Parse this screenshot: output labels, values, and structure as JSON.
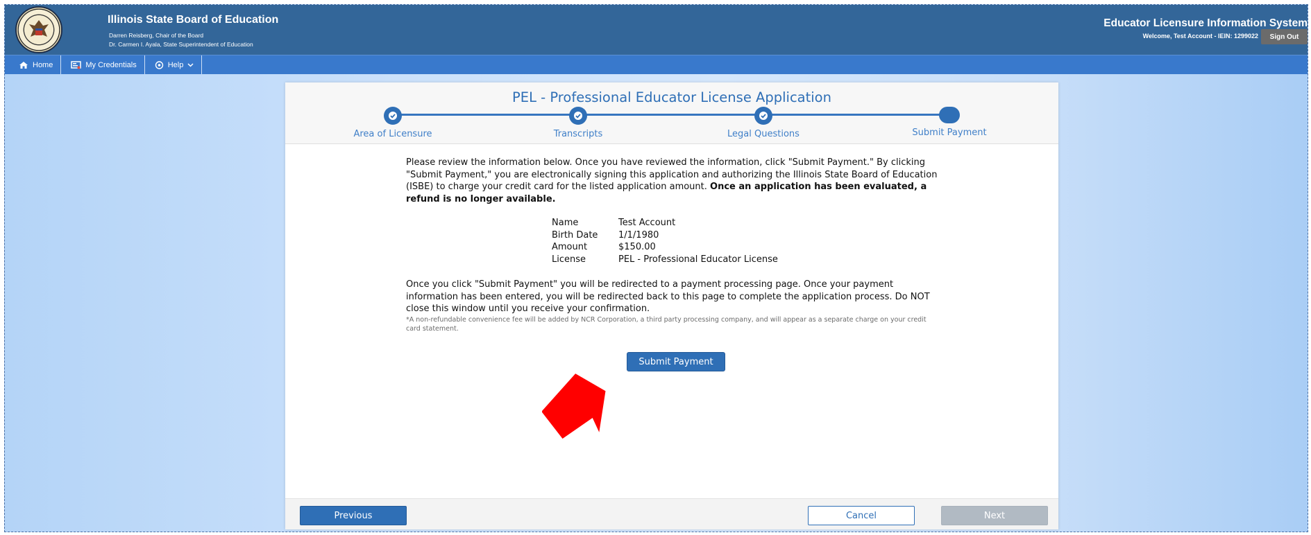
{
  "header": {
    "org_title": "Illinois State Board of Education",
    "chair_line": "Darren Reisberg, Chair of the Board",
    "superintendent_line": "Dr. Carmen I. Ayala, State Superintendent of Education",
    "system_title": "Educator Licensure Information System",
    "welcome_text": "Welcome, Test Account - IEIN: 1299022",
    "sign_out_label": "Sign Out",
    "seal_icon": "state-seal-icon"
  },
  "nav": {
    "items": [
      {
        "label": "Home",
        "icon": "home-icon"
      },
      {
        "label": "My Credentials",
        "icon": "credentials-icon"
      },
      {
        "label": "Help",
        "icon": "help-icon"
      }
    ]
  },
  "application": {
    "title": "PEL - Professional Educator License Application",
    "steps": [
      {
        "label": "Area of Licensure",
        "status": "complete"
      },
      {
        "label": "Transcripts",
        "status": "complete"
      },
      {
        "label": "Legal Questions",
        "status": "complete"
      },
      {
        "label": "Submit Payment",
        "status": "current"
      }
    ],
    "intro_text": "Please review the information below. Once you have reviewed the information, click \"Submit Payment.\" By clicking \"Submit Payment,\" you are electronically signing this application and authorizing the Illinois State Board of Education (ISBE) to charge your credit card for the listed application amount.",
    "intro_bold": "Once an application has been evaluated, a refund is no longer available.",
    "details": [
      {
        "label": "Name",
        "value": "Test Account"
      },
      {
        "label": "Birth Date",
        "value": "1/1/1980"
      },
      {
        "label": "Amount",
        "value": "$150.00"
      },
      {
        "label": "License",
        "value": "PEL - Professional Educator License"
      }
    ],
    "redirect_text": "Once you click \"Submit Payment\" you will be redirected to a payment processing page. Once your payment information has been entered, you will be redirected back to this page to complete the application process. Do NOT close this window until you receive your confirmation.",
    "fee_note": "*A non-refundable convenience fee will be added by NCR Corporation, a third party processing company, and will appear as a separate charge on your credit card statement.",
    "submit_label": "Submit Payment"
  },
  "footer": {
    "previous_label": "Previous",
    "cancel_label": "Cancel",
    "next_label": "Next"
  },
  "colors": {
    "banner": "#336699",
    "navbar": "#3979cc",
    "accent": "#2f6fb6",
    "arrow": "#ff0000",
    "disabled": "#b1bac3"
  }
}
